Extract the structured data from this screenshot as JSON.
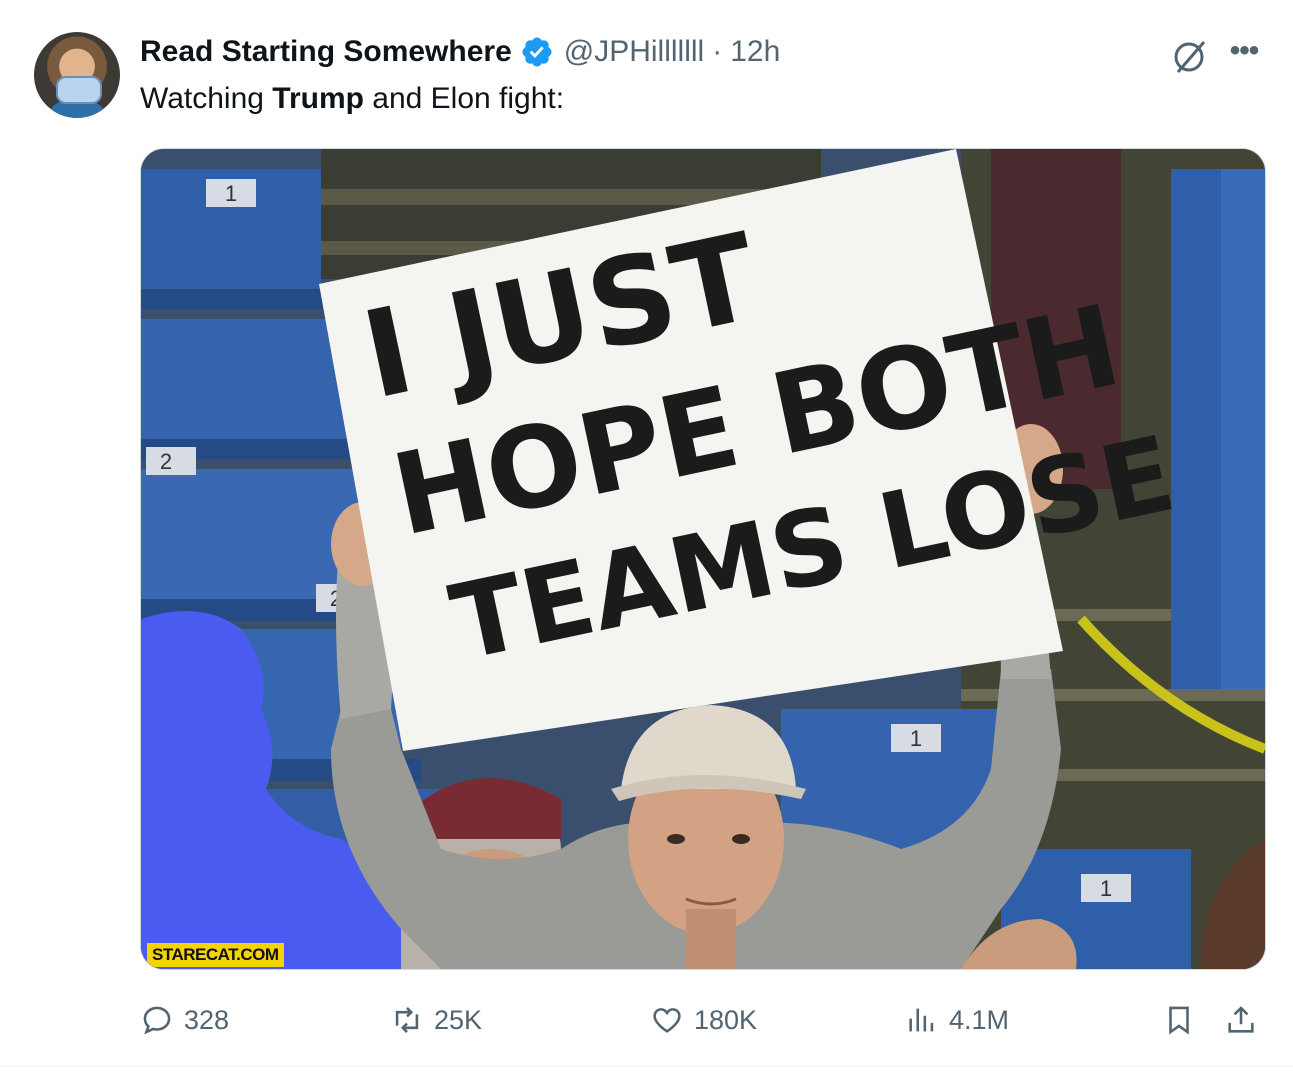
{
  "tweet": {
    "author_name": "Read Starting Somewhere",
    "handle": "@JPHilllllll",
    "separator": "·",
    "time": "12h",
    "text_before": "Watching ",
    "text_bold": "Trump",
    "text_after": " and Elon fight:"
  },
  "media": {
    "sign_lines": [
      "I JUST",
      "HOPE BOTH",
      "TEAMS LOSE"
    ],
    "seat_numbers": [
      "1",
      "2",
      "2",
      "1",
      "1"
    ],
    "watermark": "STARECAT.COM"
  },
  "actions": {
    "replies": "328",
    "reposts": "25K",
    "likes": "180K",
    "views": "4.1M"
  },
  "icons": {
    "verified": "verified-badge-icon",
    "grok": "grok-icon",
    "more": "more-icon",
    "reply": "reply-icon",
    "repost": "repost-icon",
    "like": "like-icon",
    "views": "views-icon",
    "bookmark": "bookmark-icon",
    "share": "share-icon"
  },
  "colors": {
    "accent": "#1d9bf0",
    "secondary_text": "#536471",
    "primary_text": "#0f1419"
  }
}
